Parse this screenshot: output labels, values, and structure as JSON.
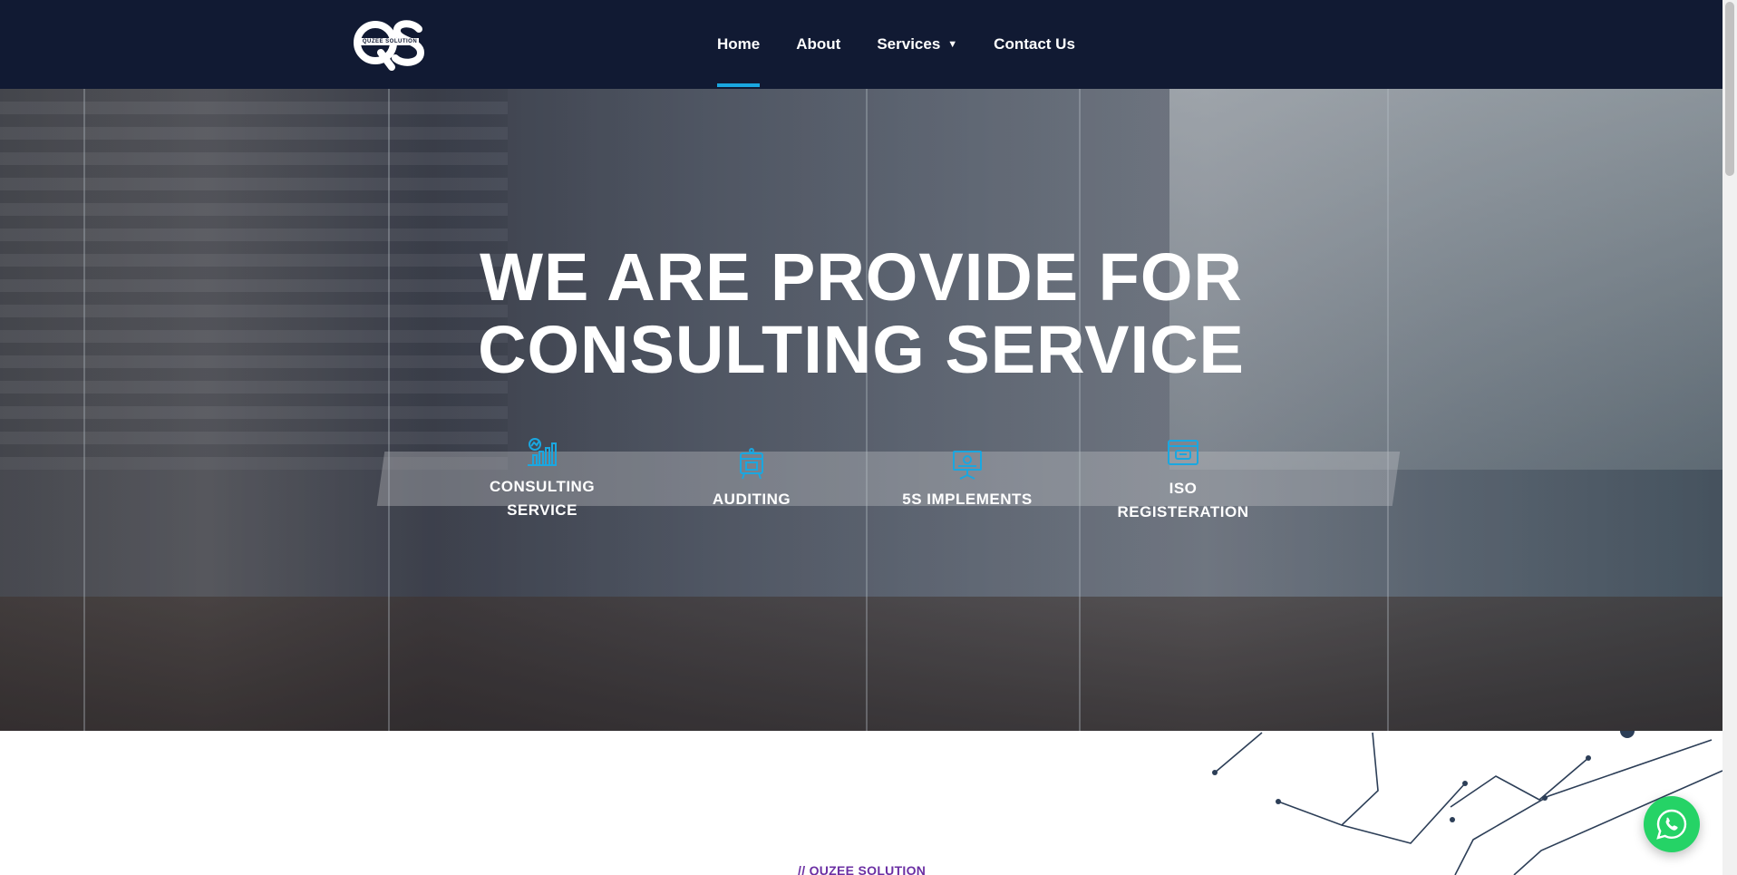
{
  "header": {
    "logo_text": "QUZEE SOLUTION",
    "nav": [
      {
        "label": "Home",
        "active": true
      },
      {
        "label": "About"
      },
      {
        "label": "Services",
        "caret": "▼"
      },
      {
        "label": "Contact Us"
      }
    ]
  },
  "hero": {
    "title_line1": "WE ARE PROVIDE FOR",
    "title_line2": "CONSULTING SERVICE",
    "features": [
      {
        "line1": "CONSULTING",
        "line2": "SERVICE",
        "icon": "chart-growth-icon"
      },
      {
        "line1": "AUDITING",
        "line2": "",
        "icon": "audit-board-icon"
      },
      {
        "line1": "5S IMPLEMENTS",
        "line2": "",
        "icon": "presentation-icon"
      },
      {
        "line1": "ISO",
        "line2": "REGISTERATION",
        "icon": "certificate-icon"
      }
    ]
  },
  "section": {
    "eyebrow": "// QUZEE SOLUTION"
  },
  "colors": {
    "header_bg": "#111a33",
    "accent": "#1aa7e0",
    "eyebrow": "#6b2fa3",
    "whatsapp": "#25d366"
  }
}
